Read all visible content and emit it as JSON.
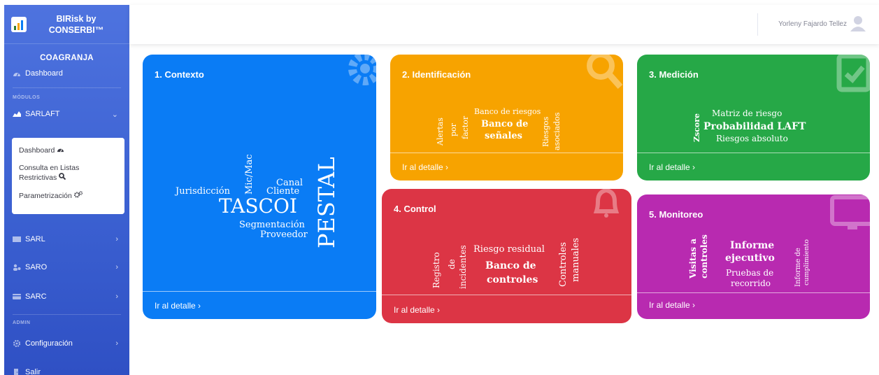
{
  "sidebar": {
    "brand_line1": "BIRisk by",
    "brand_line2": "CONSERBI™",
    "org": "COAGRANJA",
    "dashboard": "Dashboard",
    "section_modulos": "MÓDULOS",
    "sarlaft": "SARLAFT",
    "submenu": {
      "dashboard": "Dashboard",
      "consulta_line1": "Consulta en Listas",
      "consulta_line2": "Restrictivas",
      "parametrizacion": "Parametrización"
    },
    "sarl": "SARL",
    "saro": "SARO",
    "sarc": "SARC",
    "section_admin": "ADMIN",
    "configuracion": "Configuración",
    "salir": "Salir"
  },
  "topbar": {
    "user_name": "Yorleny Fajardo Tellez"
  },
  "cards": {
    "contexto": {
      "title": "1. Contexto",
      "link": "Ir al detalle ›",
      "words": {
        "micmac": "Mic/Mac",
        "canal": "Canal",
        "cliente": "Cliente",
        "jurisdiccion": "Jurisdicción",
        "tascoi": "TASCOI",
        "pestal": "PESTAL",
        "segmentacion": "Segmentación",
        "proveedor": "Proveedor"
      }
    },
    "identificacion": {
      "title": "2. Identificación",
      "link": "Ir al detalle ›",
      "words": {
        "alertas": "Alertas",
        "por": "por",
        "factor": "factor",
        "banco_riesgos": "Banco de riesgos",
        "banco_de": "Banco de",
        "senales": "señales",
        "riesgos": "Riesgos",
        "asociados": "asociados"
      }
    },
    "medicion": {
      "title": "3. Medición",
      "link": "Ir al detalle ›",
      "words": {
        "zscore": "Zscore",
        "matriz": "Matriz de riesgo",
        "probabilidad": "Probabilidad  LAFT",
        "absoluto": "Riesgos absoluto"
      }
    },
    "control": {
      "title": "4. Control",
      "link": "Ir al detalle ›",
      "words": {
        "registro": "Registro",
        "de": "de",
        "incidentes": "incidentes",
        "residual": "Riesgo residual",
        "banco_de": "Banco de",
        "controles": "controles",
        "controles2": "Controles",
        "manuales": "manuales"
      }
    },
    "monitoreo": {
      "title": "5. Monitoreo",
      "link": "Ir al detalle ›",
      "words": {
        "visitas": "Visitas a",
        "controles": "controles",
        "informe": "Informe",
        "ejecutivo": "ejecutivo",
        "pruebas": "Pruebas de",
        "recorrido": "recorrido",
        "informe_de": "Informe de",
        "cumplimiento": "cumplimiento"
      }
    }
  },
  "colors": {
    "contexto": "#0a7cf5",
    "identificacion": "#f7a300",
    "medicion": "#26a847",
    "control": "#dc3545",
    "monitoreo": "#b82ab0",
    "sidebar": "#4e73df"
  }
}
